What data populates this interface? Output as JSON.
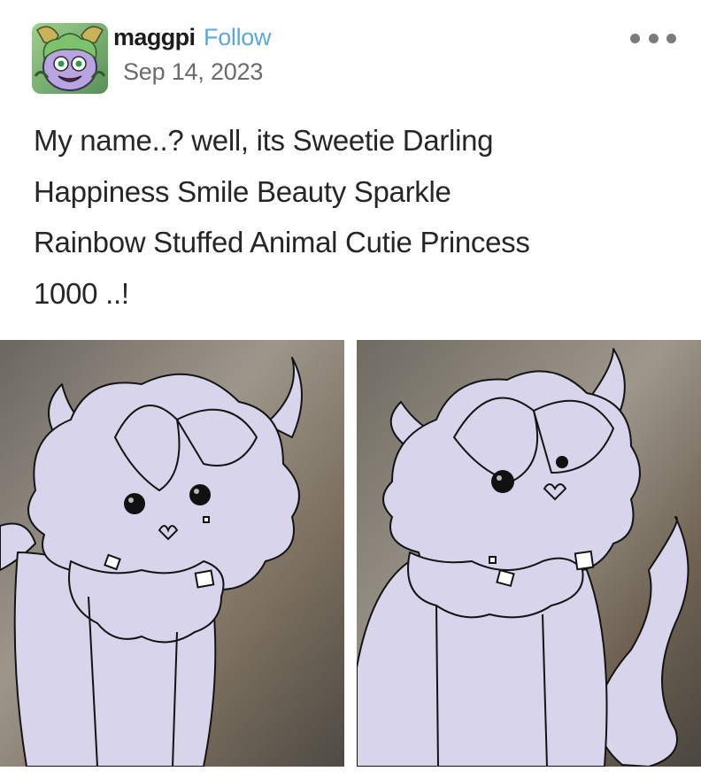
{
  "post": {
    "author": {
      "username": "maggpi",
      "follow_label": "Follow",
      "avatar_icon": "green-monster-avatar-icon"
    },
    "date": "Sep 14, 2023",
    "more_menu_icon": "ellipsis-icon",
    "body_lines": [
      "My name..? well, its Sweetie Darling",
      "Happiness Smile Beauty Sparkle",
      "Rainbow Stuffed Animal Cutie Princess",
      "1000 ..!"
    ],
    "images": [
      {
        "icon": "lavender-fluffy-creature-drawing-front"
      },
      {
        "icon": "lavender-fluffy-creature-drawing-tilted"
      }
    ]
  },
  "colors": {
    "follow_link": "#5aa9dc",
    "creature_fill": "#d8d4ec",
    "outline": "#141414",
    "date_text": "#6b6b6b"
  }
}
